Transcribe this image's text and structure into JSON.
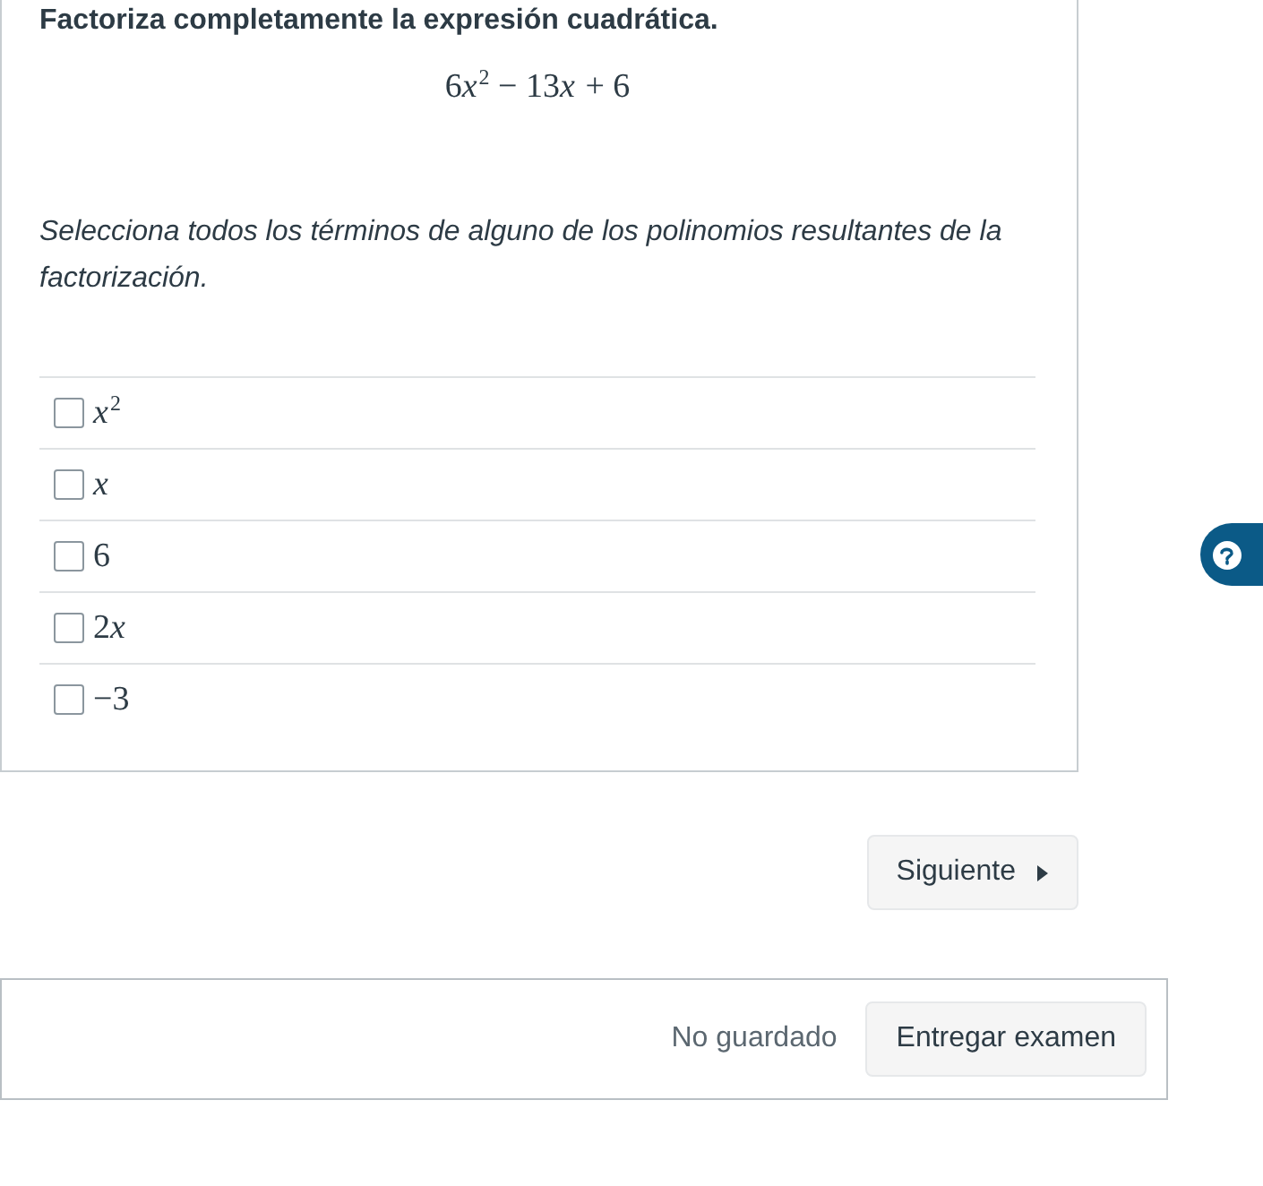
{
  "question": {
    "title": "Factoriza completamente la expresión cuadrática.",
    "expression": "6x$^{2}$ − 13x + 6",
    "instruction": "Selecciona todos los términos de alguno de los polinomios resultantes de la factorización.",
    "options": [
      {
        "label": "x$^{2}$",
        "checked": false
      },
      {
        "label": "x",
        "checked": false
      },
      {
        "label": "6",
        "checked": false
      },
      {
        "label": "2x",
        "checked": false
      },
      {
        "label": "−3",
        "checked": false
      }
    ]
  },
  "next_button": {
    "label": "Siguiente"
  },
  "footer": {
    "status": "No guardado",
    "submit_button": "Entregar examen"
  }
}
